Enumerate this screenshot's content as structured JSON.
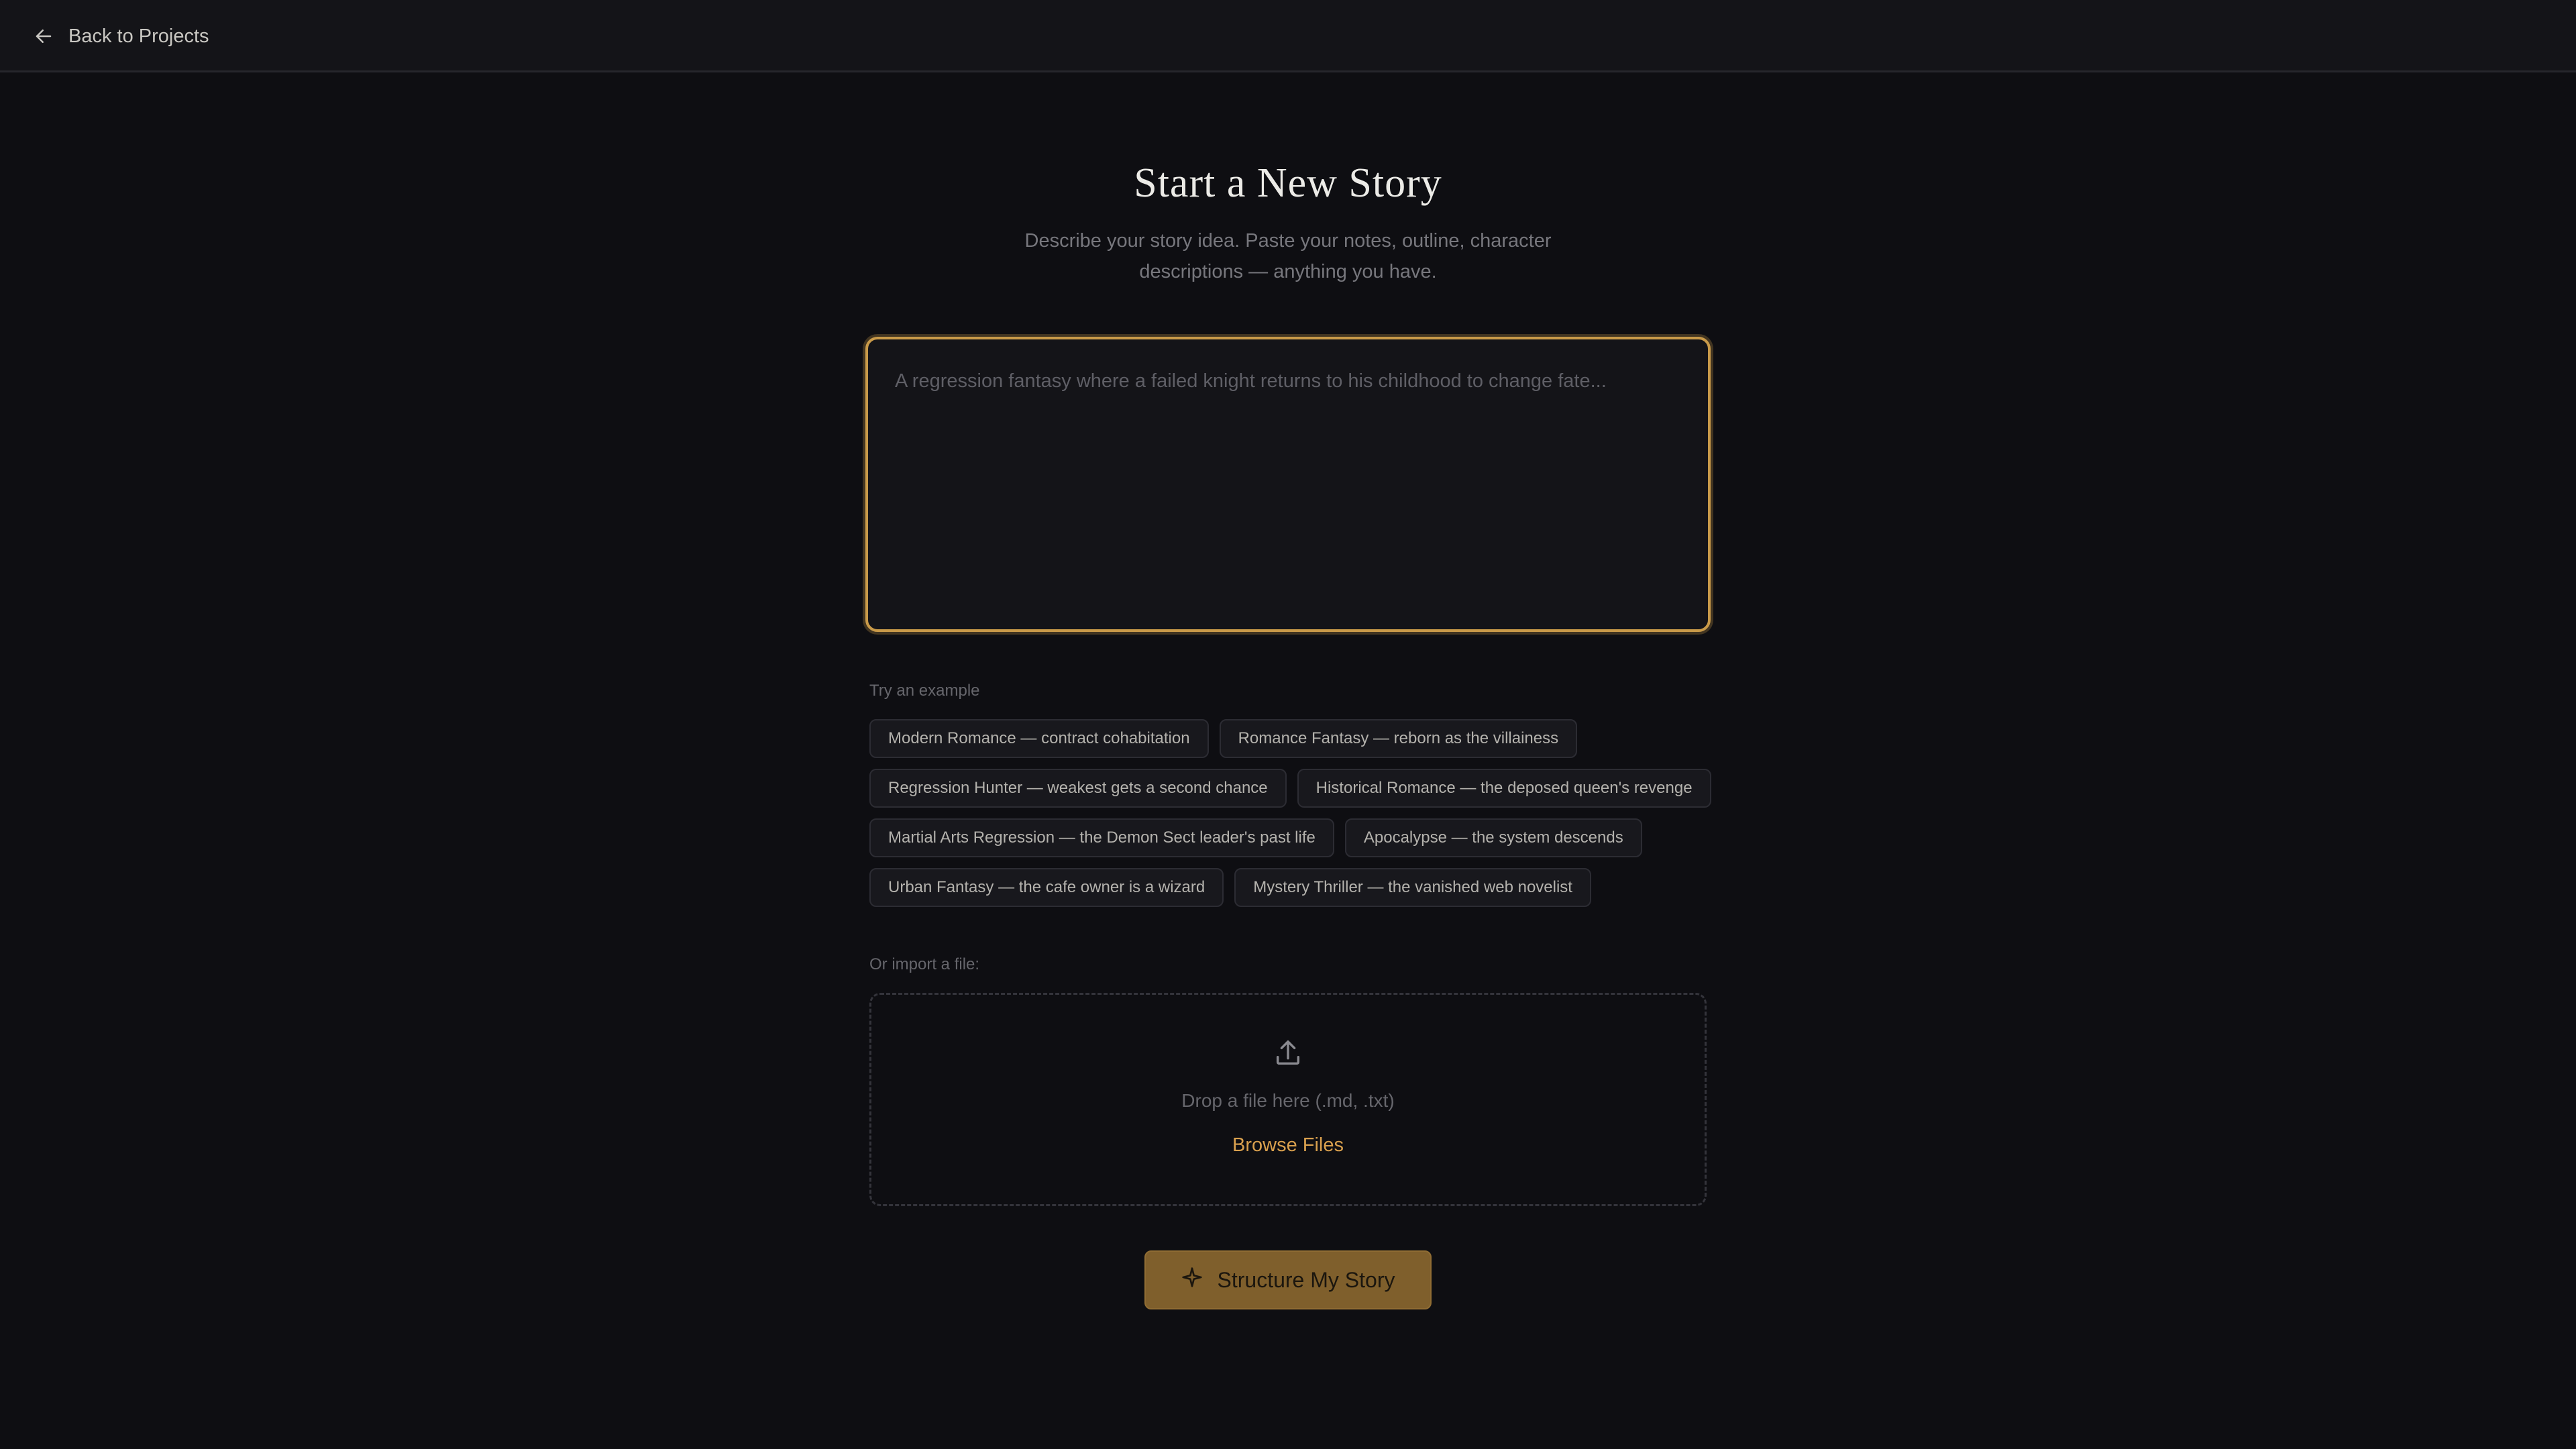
{
  "header": {
    "back_label": "Back to Projects",
    "back_icon": "arrow-left-icon"
  },
  "main": {
    "title": "Start a New Story",
    "subtitle": "Describe your story idea. Paste your notes, outline, character descriptions — anything you have.",
    "story_input": {
      "value": "",
      "placeholder": "A regression fantasy where a failed knight returns to his childhood to change fate..."
    },
    "examples": {
      "label": "Try an example",
      "items": [
        "Modern Romance — contract cohabitation",
        "Romance Fantasy — reborn as the villainess",
        "Regression Hunter — weakest gets a second chance",
        "Historical Romance — the deposed queen's revenge",
        "Martial Arts Regression — the Demon Sect leader's past life",
        "Apocalypse — the system descends",
        "Urban Fantasy — the cafe owner is a wizard",
        "Mystery Thriller — the vanished web novelist"
      ]
    },
    "import": {
      "label": "Or import a file:",
      "drop_text": "Drop a file here (.md, .txt)",
      "browse_label": "Browse Files",
      "icon": "upload-icon"
    },
    "submit": {
      "label": "Structure My Story",
      "icon": "sparkle-icon"
    }
  },
  "colors": {
    "background": "#0e0e12",
    "topbar": "#141418",
    "accent": "#d9a04e",
    "focus_border": "#c99a49",
    "primary_button": "#7f5f2c"
  }
}
